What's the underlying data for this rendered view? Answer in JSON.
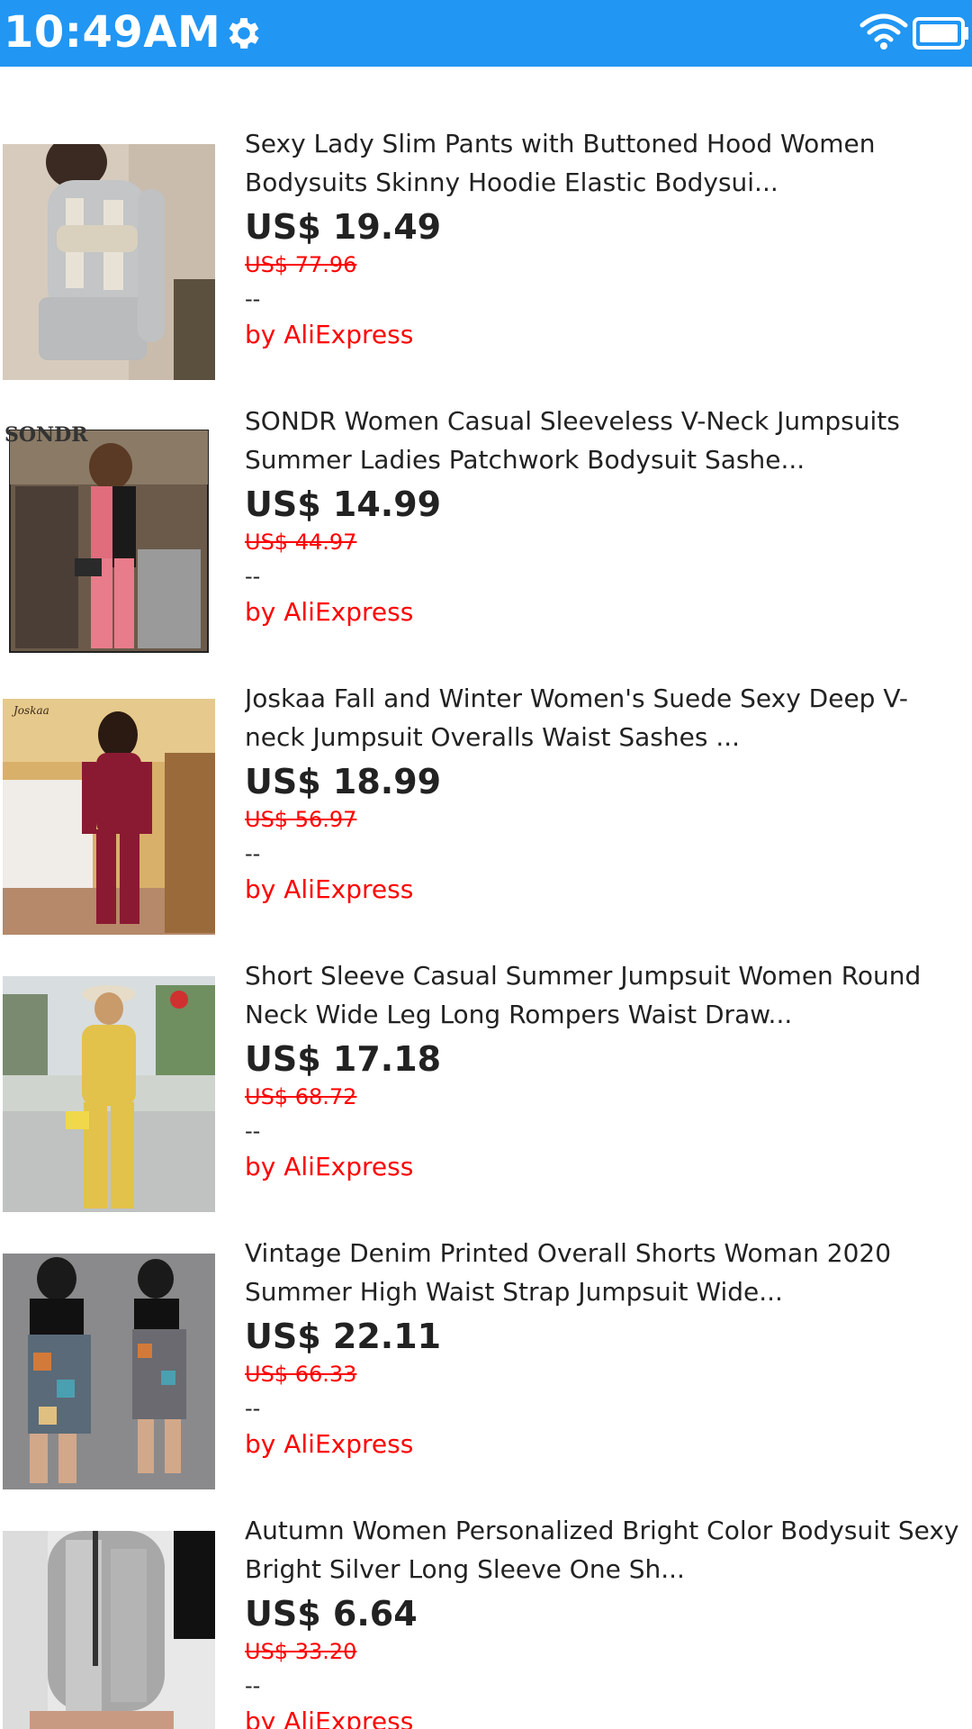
{
  "status_bar": {
    "time": "10:49AM",
    "background_color": "#2196f3",
    "icons": [
      "gear-icon",
      "wifi-icon",
      "battery-icon"
    ]
  },
  "colors": {
    "accent": "#ff0000",
    "text": "#222222"
  },
  "products": [
    {
      "title": "Sexy Lady Slim Pants with Buttoned Hood Women Bodysuits Skinny Hoodie Elastic Bodysui...",
      "price": "US$ 19.49",
      "original_price": "US$ 77.96",
      "rating": "--",
      "seller": "by AliExpress",
      "image_desc": "woman-grey-romper"
    },
    {
      "title": "SONDR Women Casual Sleeveless V-Neck Jumpsuits Summer Ladies Patchwork Bodysuit Sashe...",
      "price": "US$ 14.99",
      "original_price": "US$ 44.97",
      "rating": "--",
      "seller": "by AliExpress",
      "image_desc": "woman-pink-black-jumpsuit",
      "image_logo": "SONDR"
    },
    {
      "title": "Joskaa Fall and Winter Women's Suede Sexy Deep V-neck Jumpsuit Overalls Waist Sashes ...",
      "price": "US$ 18.99",
      "original_price": "US$ 56.97",
      "rating": "--",
      "seller": "by AliExpress",
      "image_desc": "woman-burgundy-velvet-jumpsuit",
      "image_logo": "Joskaa"
    },
    {
      "title": "Short Sleeve Casual Summer Jumpsuit Women Round Neck Wide Leg Long Rompers Waist Draw...",
      "price": "US$ 17.18",
      "original_price": "US$ 68.72",
      "rating": "--",
      "seller": "by AliExpress",
      "image_desc": "woman-yellow-jumpsuit-street"
    },
    {
      "title": "Vintage Denim Printed Overall Shorts Woman 2020 Summer High Waist Strap Jumpsuit Wide...",
      "price": "US$ 22.11",
      "original_price": "US$ 66.33",
      "rating": "--",
      "seller": "by AliExpress",
      "image_desc": "woman-printed-overall-shorts"
    },
    {
      "title": "Autumn Women Personalized Bright Color Bodysuit Sexy Bright Silver Long Sleeve One Sh...",
      "price": "US$ 6.64",
      "original_price": "US$ 33.20",
      "rating": "--",
      "seller": "by AliExpress",
      "image_desc": "woman-silver-bodysuit"
    }
  ]
}
